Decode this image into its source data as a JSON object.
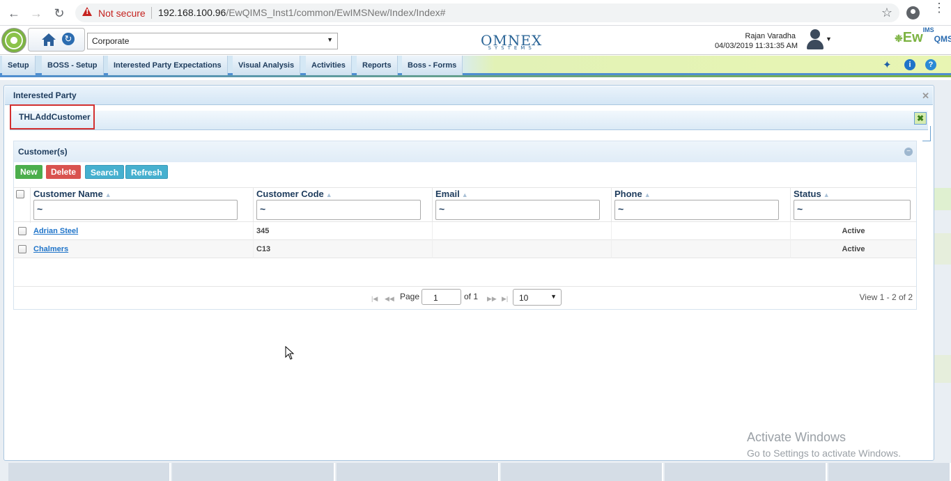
{
  "browser": {
    "warning": "Not secure",
    "url_host": "192.168.100.96",
    "url_path": "/EwQIMS_Inst1/common/EwIMSNew/Index/Index#"
  },
  "header": {
    "company": "Corporate",
    "brand_center": "OMNEX",
    "brand_center_sub": "SYSTEMS",
    "user_name": "Rajan Varadha",
    "datetime": "04/03/2019 11:31:35 AM",
    "brand_right": "Ew",
    "brand_right_sup": "IMS",
    "brand_right_tail": "QMS"
  },
  "menu": {
    "items": [
      "Setup",
      "BOSS - Setup",
      "Interested Party Expectations",
      "Visual Analysis",
      "Activities",
      "Reports",
      "Boss - Forms"
    ]
  },
  "dialog": {
    "outer_title": "Interested Party",
    "inner_title": "THLAddCustomer"
  },
  "grid": {
    "title": "Customer(s)",
    "buttons": {
      "new": "New",
      "delete": "Delete",
      "search": "Search",
      "refresh": "Refresh"
    },
    "columns": [
      "Customer Name",
      "Customer Code",
      "Email",
      "Phone",
      "Status"
    ],
    "filter_placeholder": "~",
    "rows": [
      {
        "name": "Adrian Steel",
        "code": "345",
        "email": "",
        "phone": "",
        "status": "Active"
      },
      {
        "name": "Chalmers",
        "code": "C13",
        "email": "",
        "phone": "",
        "status": "Active"
      }
    ],
    "pager": {
      "page_label": "Page",
      "page_value": "1",
      "of_label": "of 1",
      "page_size": "10",
      "view_text": "View 1 - 2 of 2"
    }
  },
  "watermark": {
    "line1": "Activate Windows",
    "line2": "Go to Settings to activate Windows."
  }
}
